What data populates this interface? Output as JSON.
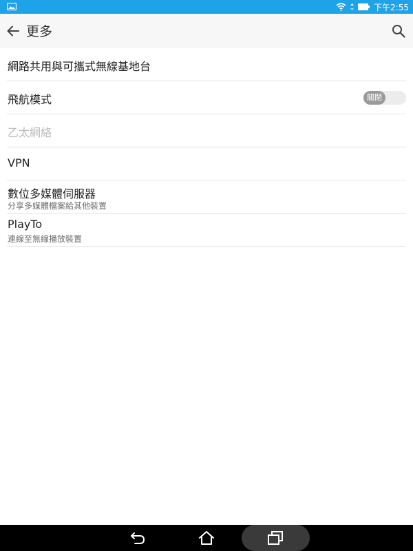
{
  "status_bar": {
    "time": "下午2:55",
    "icons": [
      "gallery-notification-icon",
      "wifi-icon",
      "data-arrows-icon",
      "battery-icon"
    ]
  },
  "app_bar": {
    "title": "更多",
    "back_icon": "arrow-left-icon",
    "search_icon": "search-icon"
  },
  "settings": {
    "items": [
      {
        "title": "網路共用與可攜式無線基地台"
      },
      {
        "title": "飛航模式",
        "toggle_label": "關閉"
      },
      {
        "title": "乙太網絡",
        "disabled": true
      },
      {
        "title": "VPN"
      },
      {
        "title": "數位多媒體伺服器",
        "subtitle": "分享多媒體檔案給其他裝置"
      },
      {
        "title": "PlayTo",
        "subtitle": "連線至無線播放裝置"
      }
    ]
  },
  "nav_bar": {
    "icons": [
      "back-nav-icon",
      "home-icon",
      "recents-icon"
    ]
  },
  "colors": {
    "status_bar": "#1fa3e8",
    "app_bar": "#f7f7f7",
    "divider": "#e2e2e2",
    "nav_bar": "#000000"
  }
}
